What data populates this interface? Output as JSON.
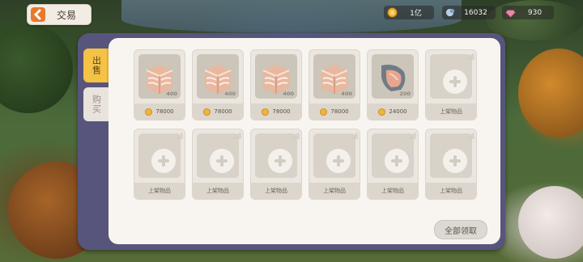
{
  "header": {
    "title": "交易"
  },
  "currencies": [
    {
      "icon": "gold-coin-icon",
      "value": "1亿"
    },
    {
      "icon": "gem-icon",
      "value": "16032"
    },
    {
      "icon": "pink-gem-icon",
      "value": "930"
    }
  ],
  "tabs": [
    {
      "label": "出售",
      "active": true
    },
    {
      "label": "购买",
      "active": false
    }
  ],
  "slots": [
    {
      "filled": true,
      "item": "meat-block-icon",
      "qty": "400",
      "price": "78000"
    },
    {
      "filled": true,
      "item": "meat-block-icon",
      "qty": "400",
      "price": "78000"
    },
    {
      "filled": true,
      "item": "meat-block-icon",
      "qty": "400",
      "price": "78000"
    },
    {
      "filled": true,
      "item": "meat-block-icon",
      "qty": "400",
      "price": "78000"
    },
    {
      "filled": true,
      "item": "fish-steak-icon",
      "qty": "200",
      "price": "24000"
    },
    {
      "filled": false,
      "label": "上架物品"
    },
    {
      "filled": false,
      "label": "上架物品"
    },
    {
      "filled": false,
      "label": "上架物品"
    },
    {
      "filled": false,
      "label": "上架物品"
    },
    {
      "filled": false,
      "label": "上架物品"
    },
    {
      "filled": false,
      "label": "上架物品"
    },
    {
      "filled": false,
      "label": "上架物品"
    }
  ],
  "footer": {
    "claim_all": "全部领取"
  },
  "colors": {
    "frame": "#57557c",
    "panel": "#f8f5f1",
    "active_tab": "#f4c244",
    "back_icon": "#e9792a"
  }
}
